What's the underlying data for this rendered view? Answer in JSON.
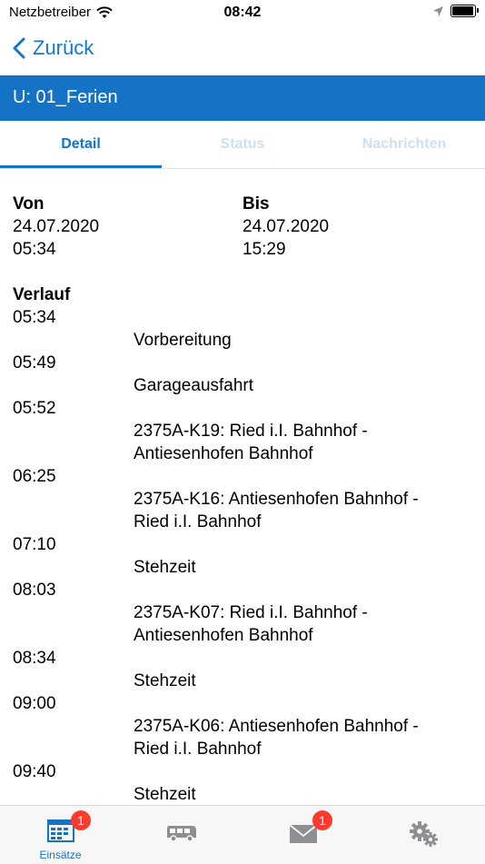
{
  "status_bar": {
    "carrier": "Netzbetreiber",
    "time": "08:42",
    "battery_level": 0.9
  },
  "nav": {
    "back_label": "Zurück"
  },
  "header": {
    "title": "U: 01_Ferien"
  },
  "tabs": [
    {
      "label": "Detail",
      "active": true
    },
    {
      "label": "Status",
      "active": false
    },
    {
      "label": "Nachrichten",
      "active": false
    }
  ],
  "detail": {
    "from": {
      "label": "Von",
      "date": "24.07.2020",
      "time": "05:34"
    },
    "to": {
      "label": "Bis",
      "date": "24.07.2020",
      "time": "15:29"
    },
    "history_label": "Verlauf",
    "history": [
      {
        "time": "05:34",
        "lines": [
          "Vorbereitung"
        ]
      },
      {
        "time": "05:49",
        "lines": [
          "Garageausfahrt"
        ]
      },
      {
        "time": "05:52",
        "lines": [
          "2375A-K19: Ried i.I. Bahnhof -",
          "Antiesenhofen Bahnhof"
        ]
      },
      {
        "time": "06:25",
        "lines": [
          "2375A-K16: Antiesenhofen Bahnhof -",
          "Ried i.I. Bahnhof"
        ]
      },
      {
        "time": "07:10",
        "lines": [
          "Stehzeit"
        ]
      },
      {
        "time": "08:03",
        "lines": [
          "2375A-K07: Ried i.I. Bahnhof -",
          "Antiesenhofen Bahnhof"
        ]
      },
      {
        "time": "08:34",
        "lines": [
          "Stehzeit"
        ]
      },
      {
        "time": "09:00",
        "lines": [
          "2375A-K06: Antiesenhofen Bahnhof -",
          "Ried i.I. Bahnhof"
        ]
      },
      {
        "time": "09:40",
        "lines": [
          "Stehzeit"
        ]
      }
    ]
  },
  "tab_bar": {
    "items": [
      {
        "name": "calendar-icon",
        "label": "Einsätze",
        "badge": "1"
      },
      {
        "name": "bus-icon",
        "label": "",
        "badge": ""
      },
      {
        "name": "mail-icon",
        "label": "",
        "badge": "1"
      },
      {
        "name": "gears-icon",
        "label": "",
        "badge": ""
      }
    ]
  },
  "colors": {
    "accent": "#1573c6",
    "badge": "#ff3b30",
    "inactive_tab": "#cfe0ee",
    "tabbar_icon": "#8e8e93"
  }
}
